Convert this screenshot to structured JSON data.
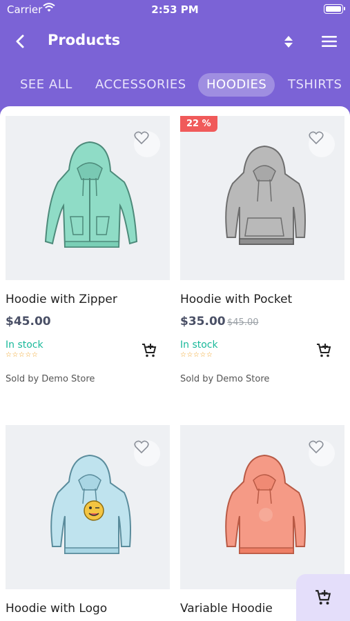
{
  "status_bar": {
    "carrier": "Carrier",
    "time": "2:53 PM"
  },
  "navbar": {
    "title": "Products"
  },
  "tabs": [
    "SEE ALL",
    "ACCESSORIES",
    "HOODIES",
    "TSHIRTS"
  ],
  "active_tab": "HOODIES",
  "colors": {
    "header": "#7b63d6",
    "in_stock": "#19b99a",
    "badge": "#f05a5a",
    "stars": "#f0a020"
  },
  "products": [
    {
      "name": "Hoodie with Zipper",
      "price": "$45.00",
      "stock": "In stock",
      "seller": "Sold by Demo Store",
      "rating_stars": "☆☆☆☆☆",
      "hoodie_color": "#8fdcc6"
    },
    {
      "name": "Hoodie with Pocket",
      "price": "$35.00",
      "old_price": "$45.00",
      "badge": "22 %",
      "stock": "In stock",
      "seller": "Sold by Demo Store",
      "rating_stars": "☆☆☆☆☆",
      "hoodie_color": "#b9b9b9"
    },
    {
      "name": "Hoodie with Logo",
      "hoodie_color": "#bfe3ee"
    },
    {
      "name": "Variable Hoodie",
      "hoodie_color": "#f59a86"
    }
  ],
  "icons": {
    "back": "chevron-left-icon",
    "sort": "sort-icon",
    "menu": "hamburger-menu-icon",
    "wishlist": "heart-icon",
    "cart": "add-to-cart-icon"
  }
}
